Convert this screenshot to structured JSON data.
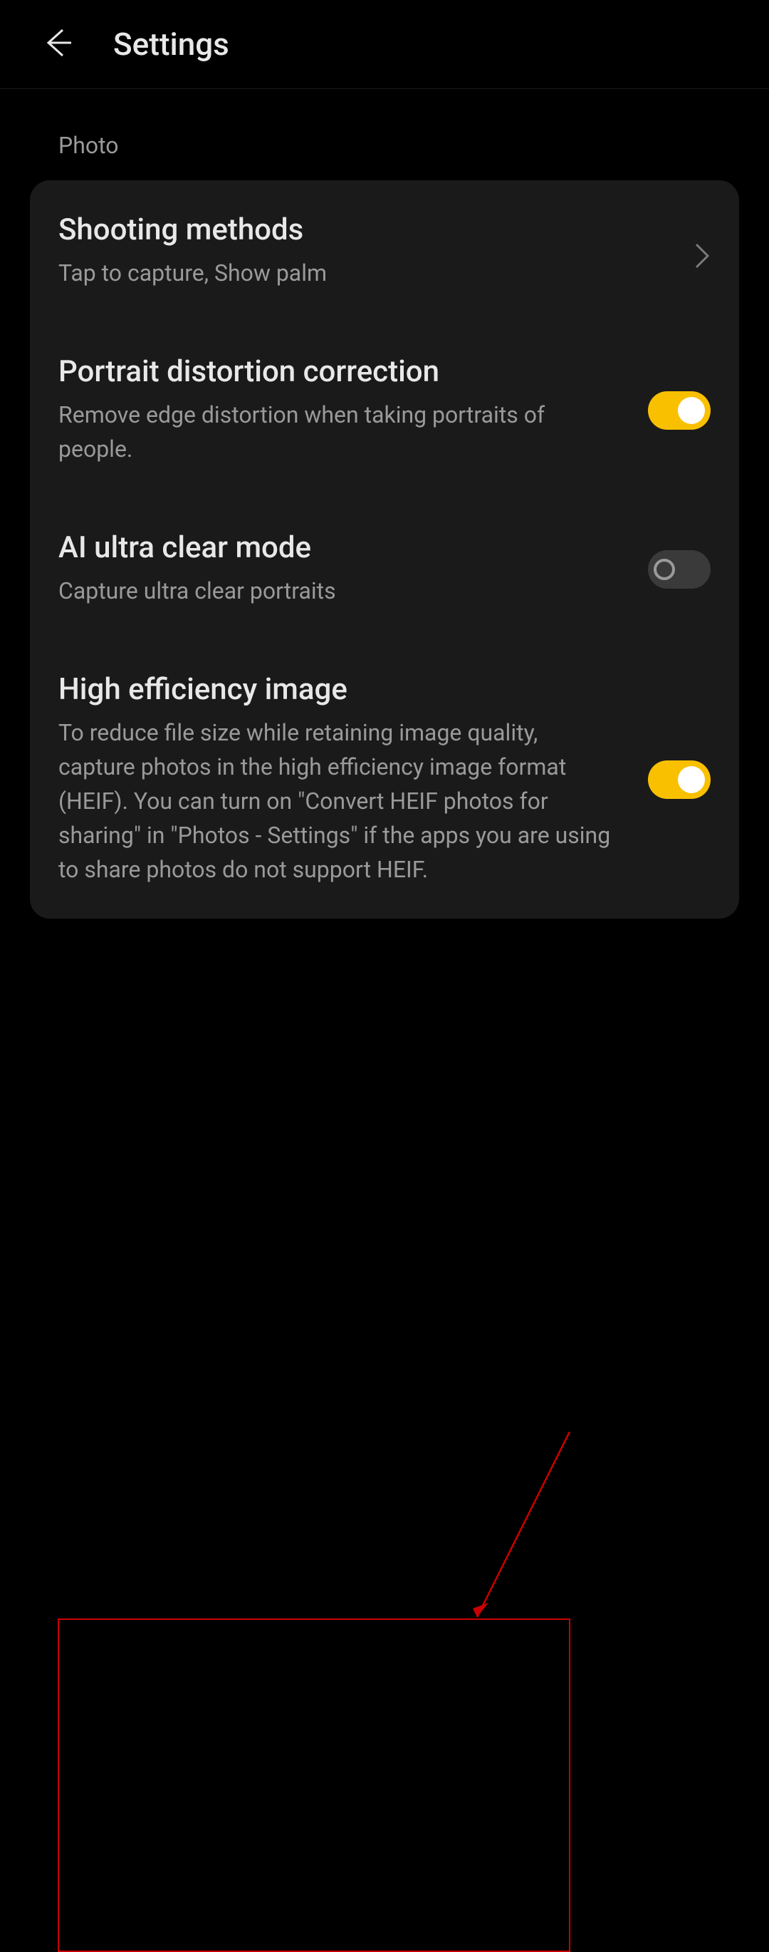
{
  "header": {
    "title": "Settings"
  },
  "section": {
    "label": "Photo"
  },
  "settings": {
    "shooting_methods": {
      "title": "Shooting methods",
      "subtitle": "Tap to capture, Show palm"
    },
    "portrait_distortion": {
      "title": "Portrait distortion correction",
      "subtitle": "Remove edge distortion when taking portraits of people.",
      "toggle": true
    },
    "ai_ultra_clear": {
      "title": "AI ultra clear mode",
      "subtitle": "Capture ultra clear portraits",
      "toggle": false
    },
    "high_efficiency": {
      "title": "High efficiency image",
      "subtitle": "To reduce file size while retaining image quality, capture photos in the high efficiency image format (HEIF). You can turn on \"Convert HEIF photos for sharing\" in \"Photos - Settings\" if the apps you are using to share photos do not support HEIF.",
      "toggle": true
    }
  }
}
